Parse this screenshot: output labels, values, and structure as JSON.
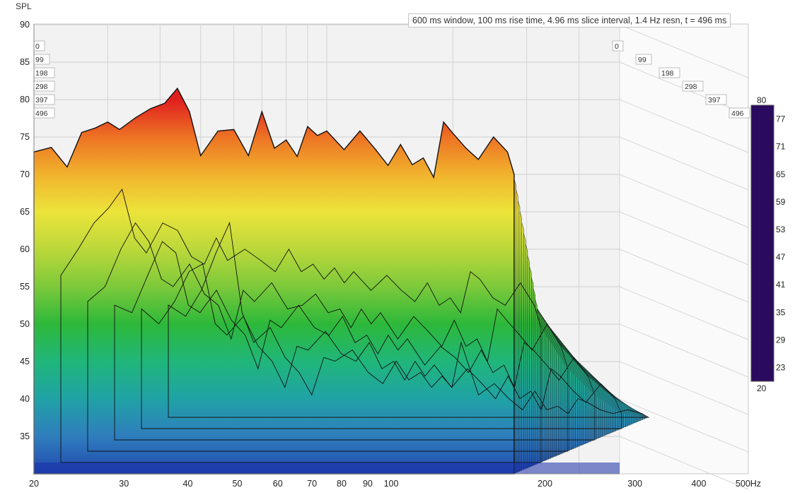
{
  "chart_data": {
    "type": "area",
    "subtype": "cumulative spectral decay (waterfall)",
    "info": "600 ms window, 100 ms rise time, 4.96 ms slice interval, 1.4 Hz resn, t = 496 ms",
    "ylabel": "SPL",
    "xunit": "Hz",
    "xscale": "log",
    "xlim": [
      20,
      500
    ],
    "ylim": [
      30,
      91
    ],
    "y_ticks": [
      35,
      40,
      45,
      50,
      55,
      60,
      65,
      70,
      75,
      80,
      85,
      90
    ],
    "x_ticks": [
      {
        "value": 20,
        "label": "20"
      },
      {
        "value": 30,
        "label": "30"
      },
      {
        "value": 40,
        "label": "40"
      },
      {
        "value": 50,
        "label": "50"
      },
      {
        "value": 60,
        "label": "60"
      },
      {
        "value": 70,
        "label": "70"
      },
      {
        "value": 80,
        "label": "80"
      },
      {
        "value": 90,
        "label": "90"
      },
      {
        "value": 100,
        "label": "100"
      },
      {
        "value": 200,
        "label": "200"
      },
      {
        "value": 300,
        "label": "300"
      },
      {
        "value": 400,
        "label": "400"
      },
      {
        "value": 500,
        "label": "500Hz"
      }
    ],
    "time_ticks_ms": [
      "0",
      "99",
      "198",
      "298",
      "397",
      "496"
    ],
    "colorbar": {
      "min": 20,
      "max": 80,
      "tick_labels": [
        "80",
        "77",
        "71",
        "65",
        "59",
        "53",
        "47",
        "41",
        "35",
        "29",
        "23",
        "20"
      ],
      "colors": [
        "#2a0a5e",
        "#1a2fa8",
        "#2f7dbd",
        "#19b59a",
        "#2db83a",
        "#a4d23a",
        "#ece43a",
        "#f49b26",
        "#e01f1f"
      ]
    },
    "series": [
      {
        "name": "0",
        "x": [
          20,
          22,
          24,
          26,
          28,
          30,
          32,
          35,
          38,
          41,
          44,
          47,
          50,
          55,
          60,
          65,
          70,
          75,
          80,
          85,
          90,
          95,
          100,
          110,
          120,
          130,
          140,
          150,
          160,
          170,
          180,
          190,
          200,
          215,
          230,
          250,
          270,
          280
        ],
        "y": [
          73.0,
          73.6,
          71.0,
          75.6,
          76.2,
          77.0,
          76.0,
          77.6,
          78.8,
          79.5,
          81.5,
          78.4,
          72.5,
          75.8,
          76.0,
          72.5,
          78.4,
          73.5,
          74.6,
          72.4,
          76.4,
          75.2,
          75.8,
          73.3,
          75.8,
          73.5,
          71.2,
          74.0,
          71.3,
          72.2,
          69.6,
          77.0,
          75.5,
          73.5,
          72.0,
          75.0,
          73.0,
          70.0
        ]
      },
      {
        "name": "99",
        "x": [
          20,
          22,
          24,
          26,
          28,
          30,
          32,
          35,
          38,
          41,
          44,
          47,
          50,
          55,
          60,
          65,
          70,
          75,
          80,
          85,
          90,
          95,
          100,
          110,
          120,
          130,
          140,
          150,
          160,
          170,
          180,
          190,
          200,
          215,
          230,
          250,
          270,
          280
        ],
        "y": [
          55.0,
          58.5,
          62.0,
          64.0,
          66.5,
          60.0,
          58.0,
          62.0,
          61.0,
          57.5,
          56.5,
          60.0,
          57.0,
          58.5,
          57.0,
          55.5,
          58.5,
          55.5,
          56.5,
          54.5,
          56.0,
          54.0,
          55.5,
          53.0,
          55.0,
          53.0,
          51.5,
          54.0,
          51.0,
          52.0,
          50.0,
          55.5,
          54.5,
          52.0,
          51.0,
          54.0,
          51.0,
          48.0
        ]
      },
      {
        "name": "198",
        "x": [
          20,
          22,
          24,
          26,
          28,
          30,
          32,
          35,
          38,
          41,
          44,
          47,
          50,
          55,
          60,
          65,
          70,
          75,
          80,
          85,
          90,
          95,
          100,
          110,
          120,
          130,
          140,
          150,
          160,
          170,
          180,
          190,
          200,
          215,
          230,
          250,
          270,
          280
        ],
        "y": [
          50.0,
          52.0,
          57.0,
          60.5,
          58.0,
          53.0,
          52.0,
          55.0,
          51.0,
          49.5,
          45.0,
          51.5,
          50.0,
          52.5,
          49.0,
          49.5,
          51.0,
          48.5,
          49.0,
          46.5,
          49.0,
          47.0,
          48.5,
          45.0,
          48.0,
          46.0,
          44.0,
          47.5,
          44.0,
          45.0,
          42.0,
          49.0,
          47.5,
          45.5,
          43.5,
          47.0,
          44.0,
          41.0
        ]
      },
      {
        "name": "298",
        "x": [
          20,
          22,
          24,
          26,
          28,
          30,
          32,
          35,
          38,
          41,
          44,
          47,
          50,
          55,
          60,
          65,
          70,
          75,
          80,
          85,
          90,
          95,
          100,
          110,
          120,
          130,
          140,
          150,
          160,
          170,
          180,
          190,
          200,
          215,
          230,
          250,
          270,
          280
        ],
        "y": [
          48.0,
          47.0,
          52.0,
          56.5,
          55.0,
          48.0,
          47.0,
          50.0,
          46.0,
          44.0,
          39.5,
          46.0,
          45.0,
          48.0,
          45.0,
          44.0,
          46.5,
          43.0,
          44.0,
          41.5,
          44.0,
          42.0,
          43.5,
          40.0,
          42.5,
          41.0,
          39.0,
          42.0,
          39.0,
          40.0,
          37.0,
          43.0,
          42.0,
          40.0,
          38.0,
          41.0,
          38.5,
          36.0
        ]
      },
      {
        "name": "397",
        "x": [
          20,
          22,
          24,
          26,
          28,
          30,
          32,
          35,
          38,
          41,
          44,
          47,
          50,
          55,
          60,
          65,
          70,
          75,
          80,
          85,
          90,
          95,
          100,
          110,
          120,
          130,
          140,
          150,
          160,
          170,
          180,
          190,
          200,
          215,
          230,
          250,
          270,
          280
        ],
        "y": [
          46.0,
          44.0,
          47.0,
          51.0,
          52.0,
          44.0,
          42.5,
          45.0,
          41.0,
          39.0,
          35.5,
          41.0,
          40.5,
          43.0,
          40.0,
          39.0,
          41.5,
          38.0,
          39.0,
          36.5,
          39.0,
          37.0,
          38.5,
          35.5,
          38.0,
          36.0,
          34.0,
          37.0,
          34.0,
          35.0,
          32.5,
          38.0,
          37.0,
          35.0,
          33.5,
          36.0,
          34.0,
          32.0
        ]
      },
      {
        "name": "496",
        "x": [
          20,
          22,
          24,
          26,
          28,
          30,
          32,
          35,
          38,
          41,
          44,
          47,
          50,
          55,
          60,
          65,
          70,
          75,
          80,
          85,
          90,
          95,
          100,
          110,
          120,
          130,
          140,
          150,
          160,
          170,
          180,
          190,
          200,
          215,
          230,
          250,
          270,
          280
        ],
        "y": [
          45.0,
          43.5,
          47.0,
          52.0,
          56.0,
          44.0,
          40.0,
          42.0,
          38.0,
          36.0,
          33.0,
          38.0,
          37.5,
          39.0,
          36.0,
          34.5,
          37.5,
          35.0,
          36.0,
          34.0,
          35.5,
          34.0,
          40.0,
          33.0,
          34.5,
          32.5,
          31.0,
          33.5,
          31.0,
          31.5,
          30.5,
          32.5,
          32.0,
          31.0,
          30.5,
          31.0,
          30.5,
          30.0
        ]
      }
    ],
    "grid": true,
    "legend": "colorbar right"
  }
}
